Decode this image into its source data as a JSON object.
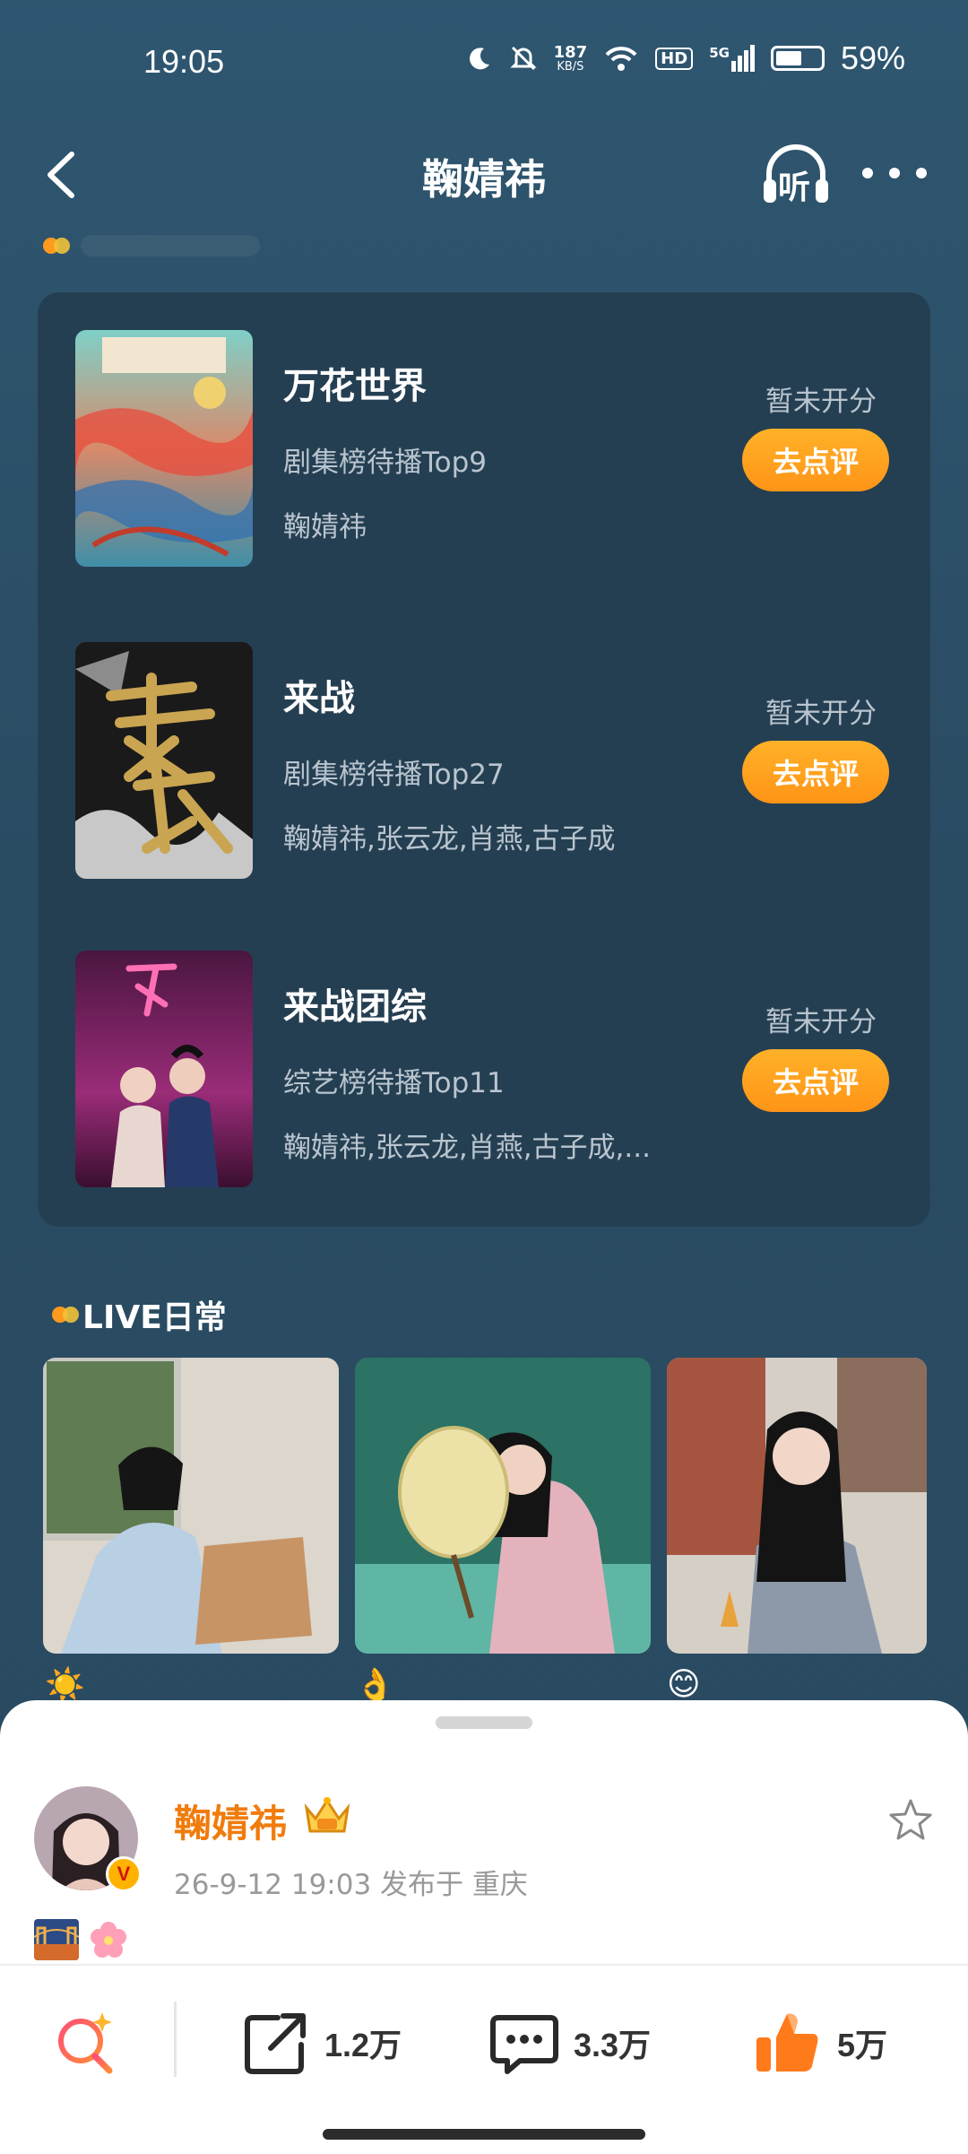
{
  "status_bar": {
    "time": "19:05",
    "net_speed_value": "187",
    "net_speed_unit": "KB/S",
    "hd_label": "HD",
    "signal_label": "5G",
    "battery_percent": "59%",
    "battery_level": 0.59,
    "icons": [
      "moon-icon",
      "mute-bell-icon",
      "wifi-icon",
      "hd-icon",
      "signal-5g-icon",
      "battery-icon"
    ]
  },
  "nav": {
    "title": "鞠婧祎",
    "listen_label": "听"
  },
  "drama_list": {
    "items": [
      {
        "title": "万花世界",
        "rank": "剧集榜待播Top9",
        "cast": "鞠婧祎",
        "score": "暂未开分",
        "button": "去点评"
      },
      {
        "title": "来战",
        "rank": "剧集榜待播Top27",
        "cast": "鞠婧祎,张云龙,肖燕,古子成",
        "score": "暂未开分",
        "button": "去点评"
      },
      {
        "title": "来战团综",
        "rank": "综艺榜待播Top11",
        "cast": "鞠婧祎,张云龙,肖燕,古子成,...",
        "score": "暂未开分",
        "button": "去点评"
      }
    ]
  },
  "live": {
    "title": "LIVE日常",
    "emojis": [
      "☀️",
      "👌",
      "😊"
    ]
  },
  "post": {
    "author": "鞠婧祎",
    "verified_mark": "V",
    "meta": "26-9-12 19:03   发布于 重庆"
  },
  "actions": {
    "share_count": "1.2万",
    "comment_count": "3.3万",
    "like_count": "5万"
  },
  "colors": {
    "background": "#2a4c63",
    "card": "#253f52",
    "accent_orange": "#ff9a1e",
    "author_orange": "#f07c0d",
    "like_orange": "#ff7a1a"
  }
}
